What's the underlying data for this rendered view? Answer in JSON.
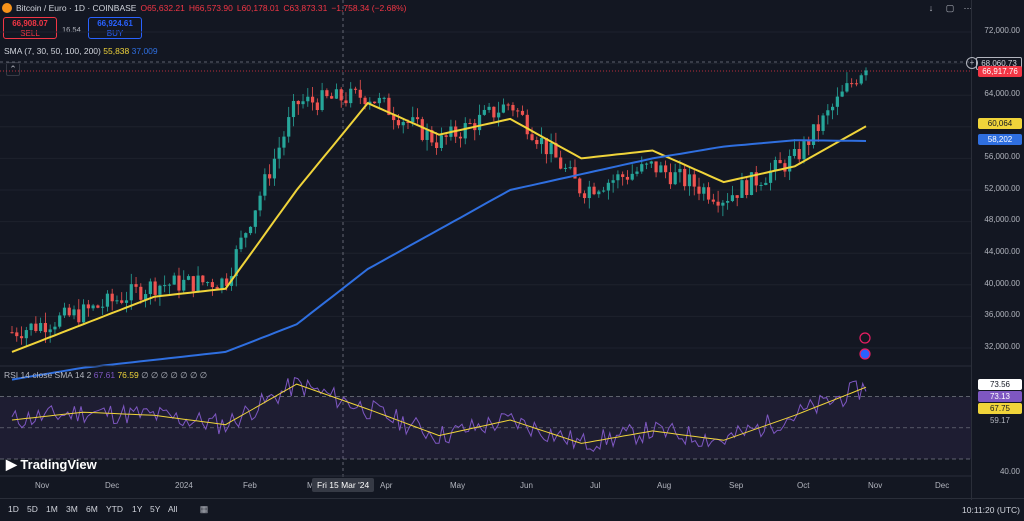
{
  "header": {
    "symbol": "Bitcoin / Euro · 1D · COINBASE",
    "o": "O65,632.21",
    "h": "H66,573.90",
    "l": "L60,178.01",
    "c": "C63,873.31",
    "chg": "−1,758.34 (−2.68%)"
  },
  "trade": {
    "sell_price": "66,908.07",
    "sell_label": "SELL",
    "spread": "16.54",
    "buy_price": "66,924.61",
    "buy_label": "BUY"
  },
  "sma": {
    "label": "SMA (7, 30, 50, 100, 200)",
    "v1": "55,838",
    "v2": "37,009",
    "c1": "#f0d43a",
    "c2": "#2f6fe0"
  },
  "price_axis": {
    "ticks": [
      "72,000.00",
      "68,000.00",
      "64,000.00",
      "60,000.00",
      "56,000.00",
      "52,000.00",
      "48,000.00",
      "44,000.00",
      "40,000.00",
      "36,000.00",
      "32,000.00"
    ],
    "tag_current": "68,060.73",
    "tag_last": "66,917.76",
    "tag_sma1": "60,064",
    "tag_sma2": "58,202"
  },
  "rsi": {
    "label": "RSI 14 close SMA 14 2",
    "v1": "67.61",
    "v2": "76.59",
    "nulls": "∅ ∅ ∅ ∅ ∅ ∅ ∅",
    "ticks": [
      "73.56",
      "73.13",
      "67.75",
      "59.17",
      "40.00"
    ]
  },
  "x_axis": [
    "Nov",
    "Dec",
    "2024",
    "Feb",
    "Mar",
    "Apr",
    "May",
    "Jun",
    "Jul",
    "Aug",
    "Sep",
    "Oct",
    "Nov",
    "Dec"
  ],
  "crosshair_date": "Fri 15 Mar '24",
  "timeframes": [
    "1D",
    "5D",
    "1M",
    "3M",
    "6M",
    "YTD",
    "1Y",
    "5Y",
    "All"
  ],
  "clock": "10:11:20 (UTC)",
  "brand": "TradingView",
  "colors": {
    "up": "#26a69a",
    "down": "#ef5350",
    "sma50": "#f0d43a",
    "sma200": "#2f6fe0",
    "rsi": "#7e57c2"
  },
  "chart_data": {
    "type": "candlestick",
    "x": [
      "Nov",
      "Dec",
      "2024",
      "Feb",
      "Mar",
      "Apr",
      "May",
      "Jun",
      "Jul",
      "Aug",
      "Sep",
      "Oct",
      "Nov"
    ],
    "close": [
      34000,
      36500,
      40000,
      40500,
      63000,
      64000,
      58000,
      63000,
      52000,
      55000,
      51000,
      56000,
      68000
    ],
    "sma_fast": [
      31500,
      35000,
      38500,
      39500,
      52000,
      63000,
      59000,
      61000,
      56000,
      57000,
      53000,
      55000,
      60064
    ],
    "sma_slow": [
      28000,
      29500,
      30500,
      31500,
      35000,
      42000,
      47000,
      52000,
      54000,
      56000,
      57500,
      58300,
      58202
    ],
    "rsi": [
      55,
      60,
      58,
      52,
      78,
      62,
      45,
      55,
      40,
      48,
      42,
      58,
      76
    ],
    "ylim": [
      30000,
      74000
    ]
  }
}
